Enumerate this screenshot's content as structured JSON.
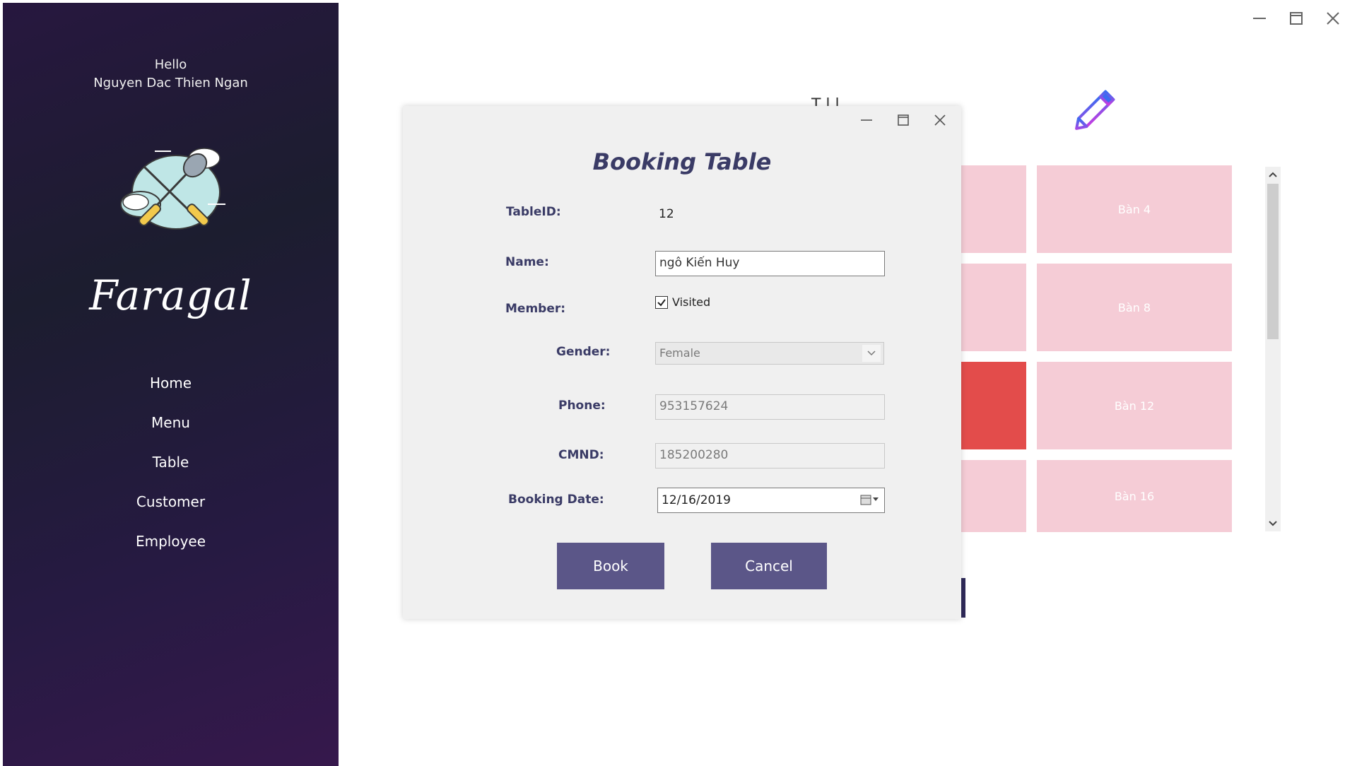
{
  "sidebar": {
    "greeting": "Hello",
    "user_name": "Nguyen Dac Thien Ngan",
    "logo_icon": "utensils-cloud-logo",
    "brand": "Faragal",
    "nav": [
      {
        "label": "Home"
      },
      {
        "label": "Menu"
      },
      {
        "label": "Table"
      },
      {
        "label": "Customer"
      },
      {
        "label": "Employee"
      }
    ]
  },
  "window": {
    "controls": [
      "minimize-icon",
      "maximize-icon",
      "close-icon"
    ]
  },
  "background": {
    "title_partial": "T  l l",
    "edit_icon": "pencil-icon",
    "tiles": [
      {
        "label": ""
      },
      {
        "label": "Bàn 4"
      },
      {
        "label": ""
      },
      {
        "label": "Bàn 8"
      },
      {
        "label": ""
      },
      {
        "label": "Bàn 12"
      },
      {
        "label": ""
      },
      {
        "label": "Bàn 16"
      }
    ],
    "tile_colors": {
      "free": "#f5ccd6",
      "busy": "#e34c4b"
    }
  },
  "dialog": {
    "title": "Booking Table",
    "fields": {
      "table_id_label": "TableID:",
      "table_id_value": "12",
      "name_label": "Name:",
      "name_value": "ngô Kiến Huy",
      "member_label": "Member:",
      "visited_label": "Visited",
      "visited_checked": true,
      "gender_label": "Gender:",
      "gender_value": "Female",
      "phone_label": "Phone:",
      "phone_value": "953157624",
      "cmnd_label": "CMND:",
      "cmnd_value": "185200280",
      "booking_date_label": "Booking Date:",
      "booking_date_value": "12/16/2019"
    },
    "buttons": {
      "book": "Book",
      "cancel": "Cancel"
    },
    "accent_color": "#5b5688"
  }
}
